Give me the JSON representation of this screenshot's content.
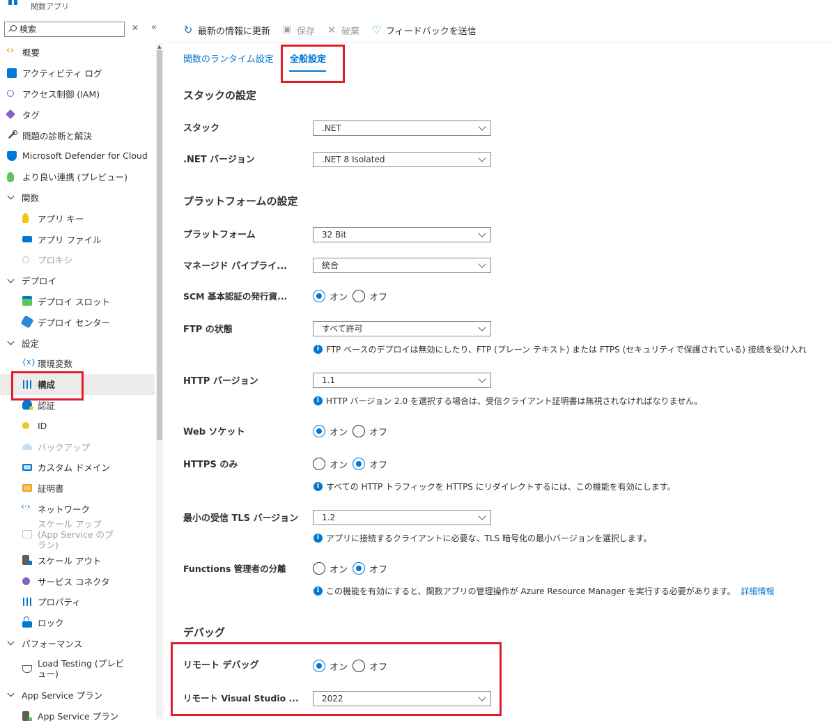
{
  "app": {
    "title": "関数アプリ"
  },
  "sidebar": {
    "search_placeholder": "検索",
    "items": [
      {
        "label": "概要"
      },
      {
        "label": "アクティビティ ログ"
      },
      {
        "label": "アクセス制御 (IAM)"
      },
      {
        "label": "タグ"
      },
      {
        "label": "問題の診断と解決"
      },
      {
        "label": "Microsoft Defender for Cloud"
      },
      {
        "label": "より良い連携 (プレビュー)"
      },
      {
        "label": "関数"
      },
      {
        "label": "アプリ キー"
      },
      {
        "label": "アプリ ファイル"
      },
      {
        "label": "プロキシ"
      },
      {
        "label": "デプロイ"
      },
      {
        "label": "デプロイ スロット"
      },
      {
        "label": "デプロイ センター"
      },
      {
        "label": "設定"
      },
      {
        "label": "環境変数"
      },
      {
        "label": "構成"
      },
      {
        "label": "認証"
      },
      {
        "label": "ID"
      },
      {
        "label": "バックアップ"
      },
      {
        "label": "カスタム ドメイン"
      },
      {
        "label": "証明書"
      },
      {
        "label": "ネットワーク"
      },
      {
        "label": "スケール アップ (App Service のプラン)"
      },
      {
        "label": "スケール アウト"
      },
      {
        "label": "サービス コネクタ"
      },
      {
        "label": "プロパティ"
      },
      {
        "label": "ロック"
      },
      {
        "label": "パフォーマンス"
      },
      {
        "label": "Load Testing (プレビュー)"
      },
      {
        "label": "App Service プラン"
      },
      {
        "label": "App Service プラン"
      }
    ]
  },
  "toolbar": {
    "refresh": "最新の情報に更新",
    "save": "保存",
    "discard": "破棄",
    "feedback": "フィードバックを送信"
  },
  "tabs": [
    {
      "label": "関数のランタイム設定"
    },
    {
      "label": "全般設定"
    }
  ],
  "sections": {
    "stack": "スタックの設定",
    "platform": "プラットフォームの設定",
    "debug": "デバッグ"
  },
  "fields": {
    "stack": {
      "label": "スタック",
      "value": ".NET"
    },
    "net_version": {
      "label": ".NET バージョン",
      "value": ".NET 8 Isolated"
    },
    "platform": {
      "label": "プラットフォーム",
      "value": "32 Bit"
    },
    "pipeline": {
      "label": "マネージド パイプライ...",
      "value": "統合"
    },
    "scm": {
      "label": "SCM 基本認証の発行資...",
      "on": "オン",
      "off": "オフ",
      "selected": "on"
    },
    "ftp": {
      "label": "FTP の状態",
      "value": "すべて許可",
      "info": "FTP ベースのデプロイは無効にしたり、FTP (プレーン テキスト) または FTPS (セキュリティで保護されている) 接続を受け入れ"
    },
    "http": {
      "label": "HTTP バージョン",
      "value": "1.1",
      "info": "HTTP バージョン 2.0 を選択する場合は、受信クライアント証明書は無視されなければなりません。"
    },
    "websocket": {
      "label": "Web ソケット",
      "on": "オン",
      "off": "オフ",
      "selected": "on"
    },
    "https": {
      "label": "HTTPS のみ",
      "on": "オン",
      "off": "オフ",
      "selected": "off",
      "info": "すべての HTTP トラフィックを HTTPS にリダイレクトするには、この機能を有効にします。"
    },
    "tls": {
      "label": "最小の受信 TLS バージョン",
      "value": "1.2",
      "info": "アプリに接続するクライアントに必要な、TLS 暗号化の最小バージョンを選択します。"
    },
    "admin_isolation": {
      "label": "Functions 管理者の分離",
      "on": "オン",
      "off": "オフ",
      "selected": "off",
      "info": "この機能を有効にすると、関数アプリの管理操作が Azure Resource Manager を実行する必要があります。",
      "link": "詳細情報"
    },
    "remote_debug": {
      "label": "リモート デバッグ",
      "on": "オン",
      "off": "オフ",
      "selected": "on"
    },
    "remote_vs": {
      "label": "リモート Visual Studio ...",
      "value": "2022"
    }
  },
  "colors": {
    "accent": "#0078d4",
    "highlight": "#e01e28"
  }
}
